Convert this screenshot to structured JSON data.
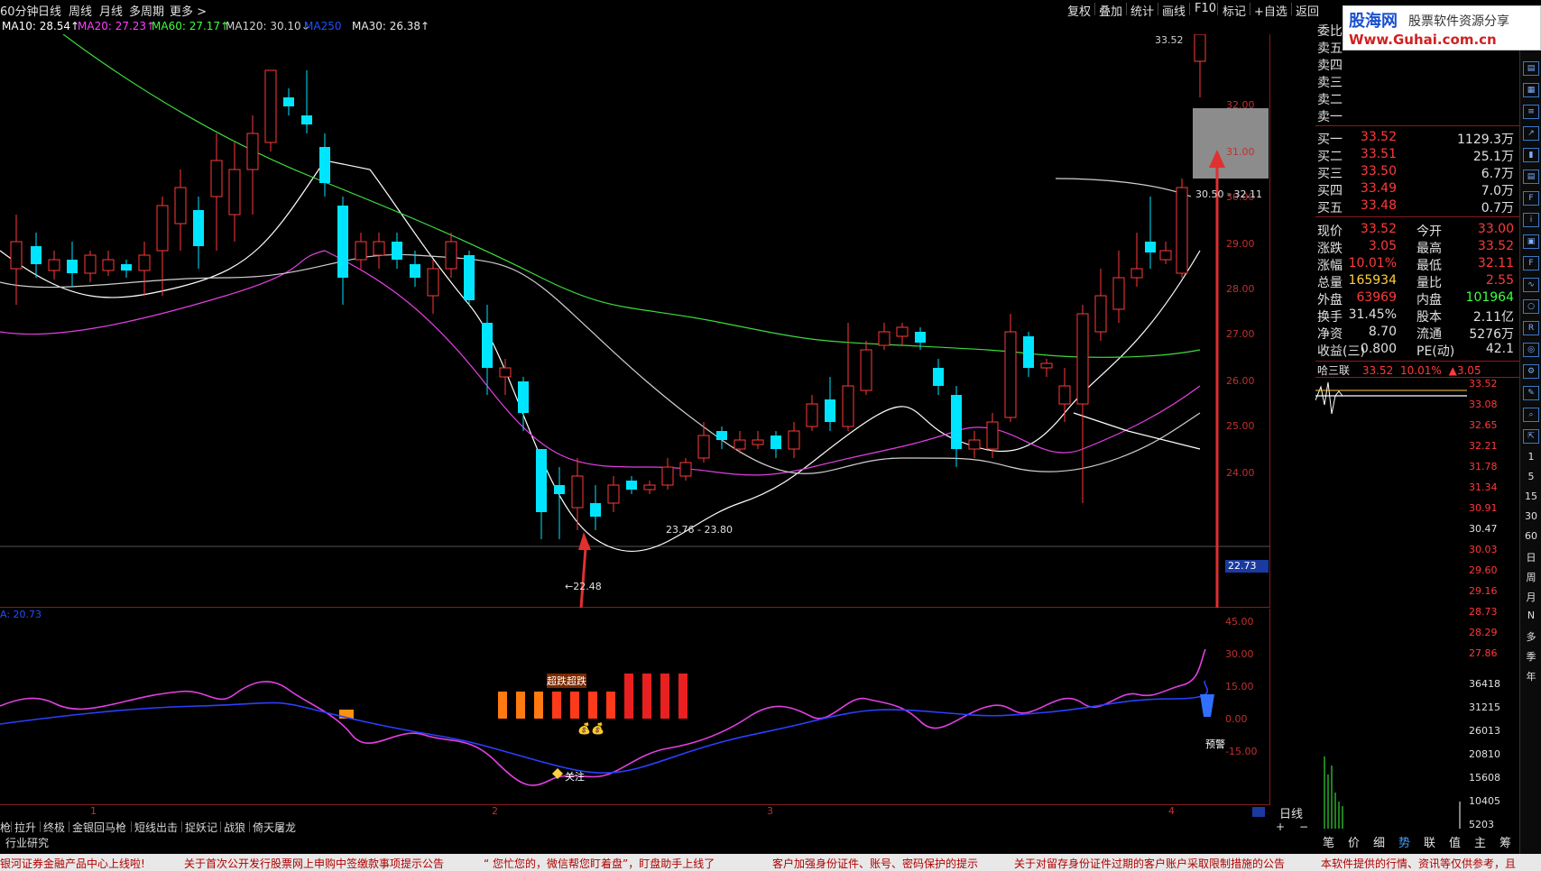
{
  "toolbar": {
    "period_tabs": [
      "60分钟",
      "日线",
      "周线",
      "月线",
      "多周期",
      "更多 >"
    ],
    "tools": [
      "复权",
      "叠加",
      "统计",
      "画线",
      "F10",
      "标记",
      "+自选",
      "返回"
    ]
  },
  "ma_legend": [
    {
      "label": "MA10: 28.54",
      "color": "#ffffff",
      "arrow": "↑"
    },
    {
      "label": "MA20: 27.23",
      "color": "#ff40ff",
      "arrow": "↑"
    },
    {
      "label": "MA60: 27.17",
      "color": "#40ff40",
      "arrow": "↑"
    },
    {
      "label": "MA120: 30.10",
      "color": "#d0d0d0",
      "arrow": "↓"
    },
    {
      "label": "MA250",
      "color": "#2050ff",
      "arrow": ""
    },
    {
      "label": "MA30: 26.38",
      "color": "#e8e8e8",
      "arrow": "↑"
    }
  ],
  "main_axis": [
    "32.00",
    "31.00",
    "30.00",
    "29.00",
    "28.00",
    "27.00",
    "26.00",
    "25.00",
    "24.00"
  ],
  "current_price_tag": "22.73",
  "annotations": {
    "high_label": "33.52",
    "range_upper": "30.50 - 32.11",
    "range_lower": "23.76 - 23.80",
    "low_label": "22.48",
    "signal_text": "超跌超跌",
    "focus_text": "关注",
    "alert_text": "预警",
    "osc_value": "A: 20.73"
  },
  "osc_axis": [
    "45.00",
    "30.00",
    "15.00",
    "0.00",
    "-15.00"
  ],
  "x_axis_labels": [
    "1",
    "2",
    "3",
    "4"
  ],
  "period_label": "日线",
  "indicator_tabs": [
    "枪",
    "拉升",
    "终极",
    "金银回马枪",
    "短线出击",
    "捉妖记",
    "战狼",
    "倚天屠龙"
  ],
  "industry_tab": "行业研究",
  "news": [
    "银河证券金融产品中心上线啦!",
    "关于首次公开发行股票网上申购中签缴款事项提示公告",
    "“ 您忙您的，微信帮您盯着盘”，盯盘助手上线了",
    "客户加强身份证件、账号、密码保护的提示",
    "关于对留存身份证件过期的客户账户采取限制措施的公告",
    "本软件提供的行情、资讯等仅供参考，且"
  ],
  "watermark": {
    "line1": "股海网",
    "line2": "股票软件资源分享",
    "url": "Www.Guhai.com.cn"
  },
  "quote": {
    "header": "委比",
    "sell": [
      "卖五",
      "卖四",
      "卖三",
      "卖二",
      "卖一"
    ],
    "buy": [
      {
        "label": "买一",
        "price": "33.52",
        "vol": "1129.3万"
      },
      {
        "label": "买二",
        "price": "33.51",
        "vol": "25.1万"
      },
      {
        "label": "买三",
        "price": "33.50",
        "vol": "6.7万"
      },
      {
        "label": "买四",
        "price": "33.49",
        "vol": "7.0万"
      },
      {
        "label": "买五",
        "price": "33.48",
        "vol": "0.7万"
      }
    ],
    "stats": [
      {
        "l1": "现价",
        "v1": "33.52",
        "l2": "今开",
        "v2": "33.00",
        "c1": "#ff3a3a",
        "c2": "#ff3a3a"
      },
      {
        "l1": "涨跌",
        "v1": "3.05",
        "l2": "最高",
        "v2": "33.52",
        "c1": "#ff3a3a",
        "c2": "#ff3a3a"
      },
      {
        "l1": "涨幅",
        "v1": "10.01%",
        "l2": "最低",
        "v2": "32.11",
        "c1": "#ff3a3a",
        "c2": "#ff3a3a"
      },
      {
        "l1": "总量",
        "v1": "165934",
        "l2": "量比",
        "v2": "2.55",
        "c1": "#ffd040",
        "c2": "#ff3a3a"
      },
      {
        "l1": "外盘",
        "v1": "63969",
        "l2": "内盘",
        "v2": "101964",
        "c1": "#ff3a3a",
        "c2": "#40ff40"
      },
      {
        "l1": "换手",
        "v1": "31.45%",
        "l2": "股本",
        "v2": "2.11亿",
        "c1": "#e0e0e0",
        "c2": "#e0e0e0"
      },
      {
        "l1": "净资",
        "v1": "8.70",
        "l2": "流通",
        "v2": "5276万",
        "c1": "#e0e0e0",
        "c2": "#e0e0e0"
      },
      {
        "l1": "收益(三)",
        "v1": "0.800",
        "l2": "PE(动)",
        "v2": "42.1",
        "c1": "#e0e0e0",
        "c2": "#e0e0e0"
      }
    ]
  },
  "mini": {
    "name": "哈三联",
    "price": "33.52",
    "pct": "10.01%",
    "chg": "▲3.05",
    "price_axis": [
      "33.52",
      "33.08",
      "32.65",
      "32.21",
      "31.78",
      "31.34",
      "30.91",
      "30.47",
      "30.03",
      "29.60",
      "29.16",
      "28.73",
      "28.29",
      "27.86"
    ],
    "vol_axis": [
      "36418",
      "31215",
      "26013",
      "20810",
      "15608",
      "10405",
      "5203"
    ]
  },
  "bottom_tabs": [
    "笔",
    "价",
    "细",
    "势",
    "联",
    "值",
    "主",
    "筹"
  ],
  "side_periods": [
    "1",
    "5",
    "15",
    "30",
    "60",
    "日",
    "周",
    "月",
    "N",
    "多",
    "季",
    "年"
  ],
  "colors": {
    "up": "#ff3a3a",
    "down": "#00e5ff",
    "border": "#8b1a1a"
  }
}
